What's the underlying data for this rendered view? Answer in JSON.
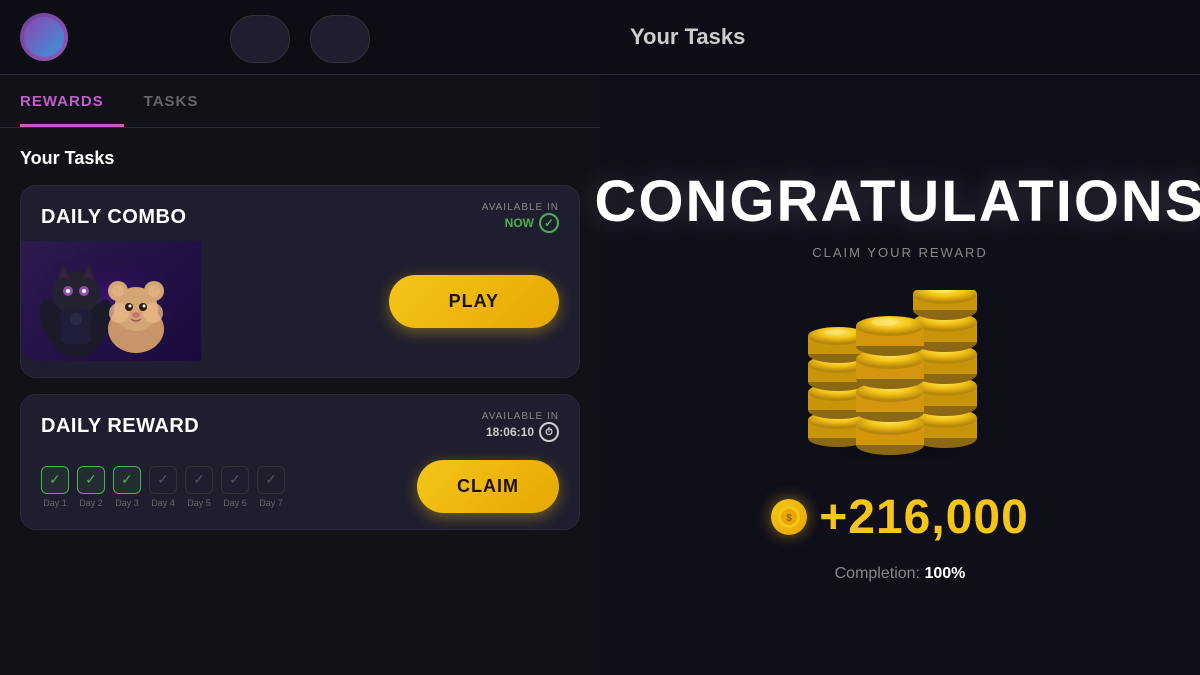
{
  "left": {
    "tabs": [
      {
        "label": "REWARDS",
        "active": true
      },
      {
        "label": "TASKS",
        "active": false
      }
    ],
    "your_tasks_label": "Your Tasks",
    "daily_combo": {
      "title": "DAILY COMBO",
      "available_label": "AVAILABLE IN",
      "available_value": "NOW",
      "play_label": "PLAY"
    },
    "daily_reward": {
      "title": "DAILY REWARD",
      "available_label": "AVAILABLE IN",
      "available_value": "18:06:10",
      "claim_label": "CLAIM",
      "days": [
        {
          "label": "Day 1",
          "checked": true
        },
        {
          "label": "Day 2",
          "checked": true
        },
        {
          "label": "Day 3",
          "checked": true
        },
        {
          "label": "Day 4",
          "checked": false
        },
        {
          "label": "Day 5",
          "checked": false
        },
        {
          "label": "Day 6",
          "checked": false
        },
        {
          "label": "Day 7",
          "checked": false
        }
      ]
    }
  },
  "right": {
    "header_title": "Your Tasks",
    "congrats_title": "CONGRATULATIONS",
    "claim_reward_sub": "CLAIM YOUR REWARD",
    "reward_amount": "+216,000",
    "completion_label": "Completion:",
    "completion_value": "100%"
  }
}
